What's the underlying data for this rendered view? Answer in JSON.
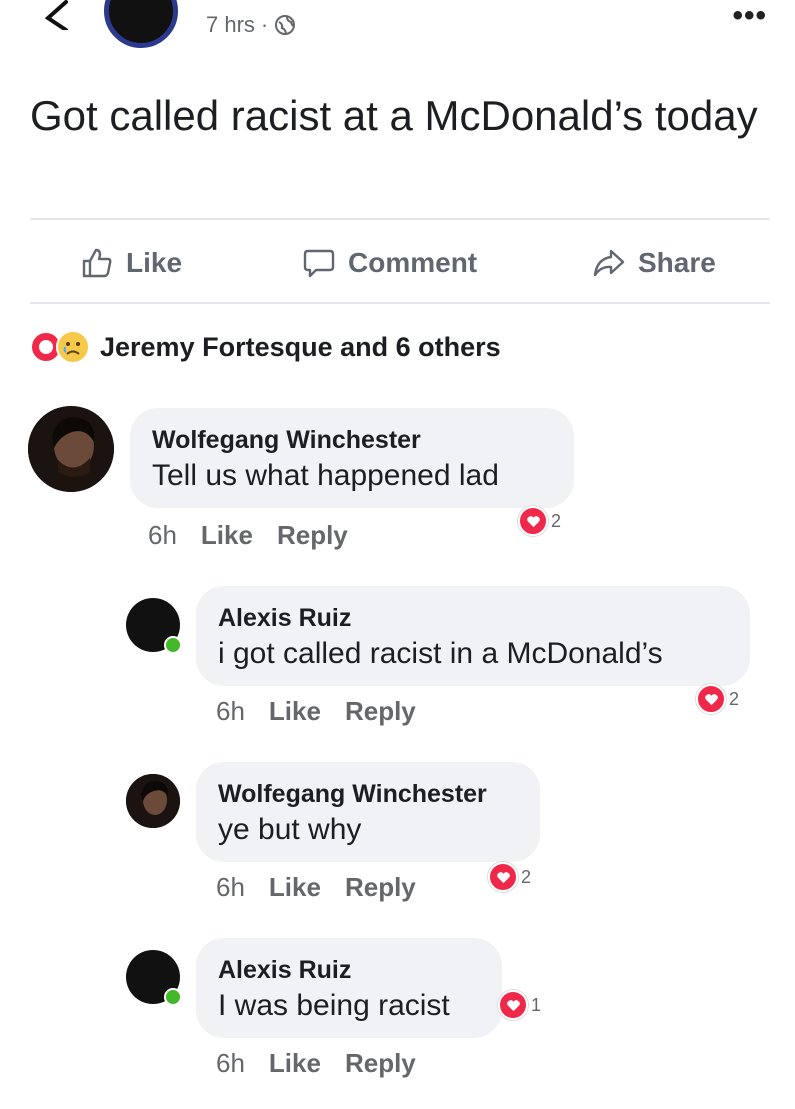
{
  "header": {
    "time": "7 hrs",
    "separator": "·",
    "more": "•••"
  },
  "post": {
    "text": "Got called racist at a McDonald’s today"
  },
  "actions": {
    "like": "Like",
    "comment": "Comment",
    "share": "Share"
  },
  "reactions": {
    "summary": "Jeremy Fortesque and 6 others"
  },
  "comments": [
    {
      "author": "Wolfegang Winchester",
      "text": "Tell us what happened lad",
      "time": "6h",
      "like": "Like",
      "reply": "Reply",
      "reaction_count": "2"
    },
    {
      "author": "Alexis Ruiz",
      "text": "i got called racist in a McDonald’s",
      "time": "6h",
      "like": "Like",
      "reply": "Reply",
      "reaction_count": "2"
    },
    {
      "author": "Wolfegang Winchester",
      "text": "ye but why",
      "time": "6h",
      "like": "Like",
      "reply": "Reply",
      "reaction_count": "2"
    },
    {
      "author": "Alexis Ruiz",
      "text": "I was being racist",
      "time": "6h",
      "like": "Like",
      "reply": "Reply",
      "reaction_count": "1"
    }
  ],
  "colors": {
    "reaction_heart": "#f0284a",
    "online": "#42b72a",
    "bubble": "#f0f2f5",
    "muted": "#65676b"
  }
}
